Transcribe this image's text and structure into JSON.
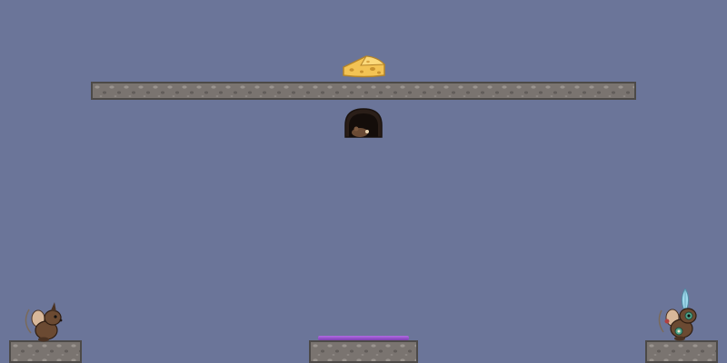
{
  "scene": {
    "background_color": "#6b7599",
    "stone_color": "#7a7470",
    "goo_color": "#9b59d0"
  },
  "sprites": {
    "cheese": "cheese-icon",
    "mouse_hole": "mouse-hole-icon",
    "player_mouse": "mouse-icon",
    "shaman_mouse": "shaman-mouse-icon"
  }
}
